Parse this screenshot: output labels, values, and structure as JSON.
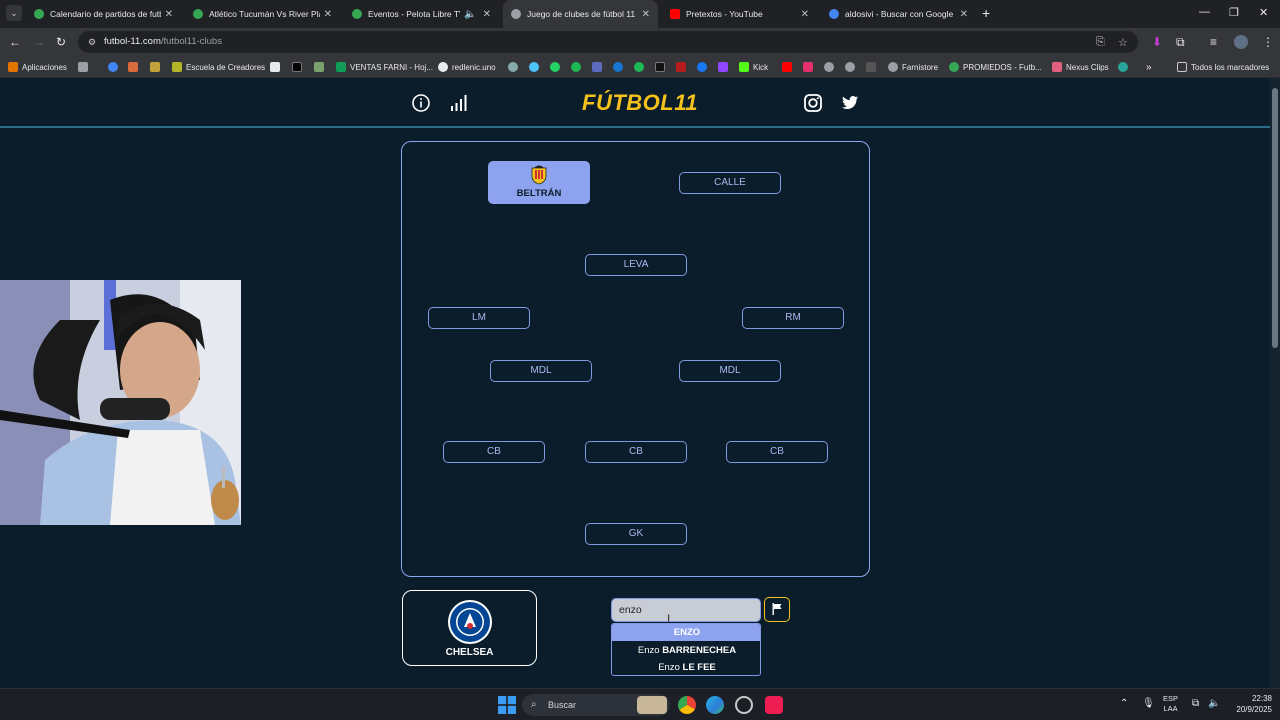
{
  "browser": {
    "tabs": [
      {
        "label": "Calendario de partidos de futbol",
        "active": false,
        "color": "#34a853"
      },
      {
        "label": "Atlético Tucumán Vs River Plate",
        "active": false,
        "color": "#34a853"
      },
      {
        "label": "Eventos - Pelota Libre TV",
        "active": false,
        "color": "#34a853"
      },
      {
        "label": "Juego de clubes de fútbol 11",
        "active": true,
        "color": "#9aa0a6"
      },
      {
        "label": "Pretextos - YouTube",
        "active": false,
        "color": "#ff0000"
      },
      {
        "label": "aldosivi - Buscar con Google",
        "active": false,
        "color": "#4285f4"
      }
    ],
    "url_domain": "futbol-11.com",
    "url_path": "/futbol11-clubs",
    "bookmarks": [
      "Aplicaciones",
      "Escuela de Creadores",
      "VENTAS FARNI - Hoj...",
      "redlenic.uno",
      "Kick",
      "Farnistore",
      "PROMIEDOS - Futb...",
      "Nexus Clips",
      "Todos los marcadores"
    ]
  },
  "game": {
    "logo": "FÚTBOL11",
    "pitch": {
      "filled_player": "BELTRÁN",
      "positions": {
        "top_right": "CALLE",
        "leva": "LEVA",
        "lm": "LM",
        "rm": "RM",
        "mdl_left": "MDL",
        "mdl_right": "MDL",
        "cb_left": "CB",
        "cb_center": "CB",
        "cb_right": "CB",
        "gk": "GK"
      }
    },
    "club": {
      "name": "CHELSEA"
    },
    "search": {
      "value": "enzo "
    },
    "suggestions": [
      {
        "first": "",
        "last": "ENZO"
      },
      {
        "first": "Enzo ",
        "last": "BARRENECHEA"
      },
      {
        "first": "Enzo ",
        "last": "LE FEE"
      }
    ]
  },
  "taskbar": {
    "search_label": "Buscar",
    "lang_line1": "ESP",
    "lang_line2": "LAA",
    "time": "22:38",
    "date": "20/9/2025"
  },
  "colors": {
    "accent": "#8ea3ef",
    "logo": "#f5c21b",
    "background": "#0b1d2a"
  }
}
